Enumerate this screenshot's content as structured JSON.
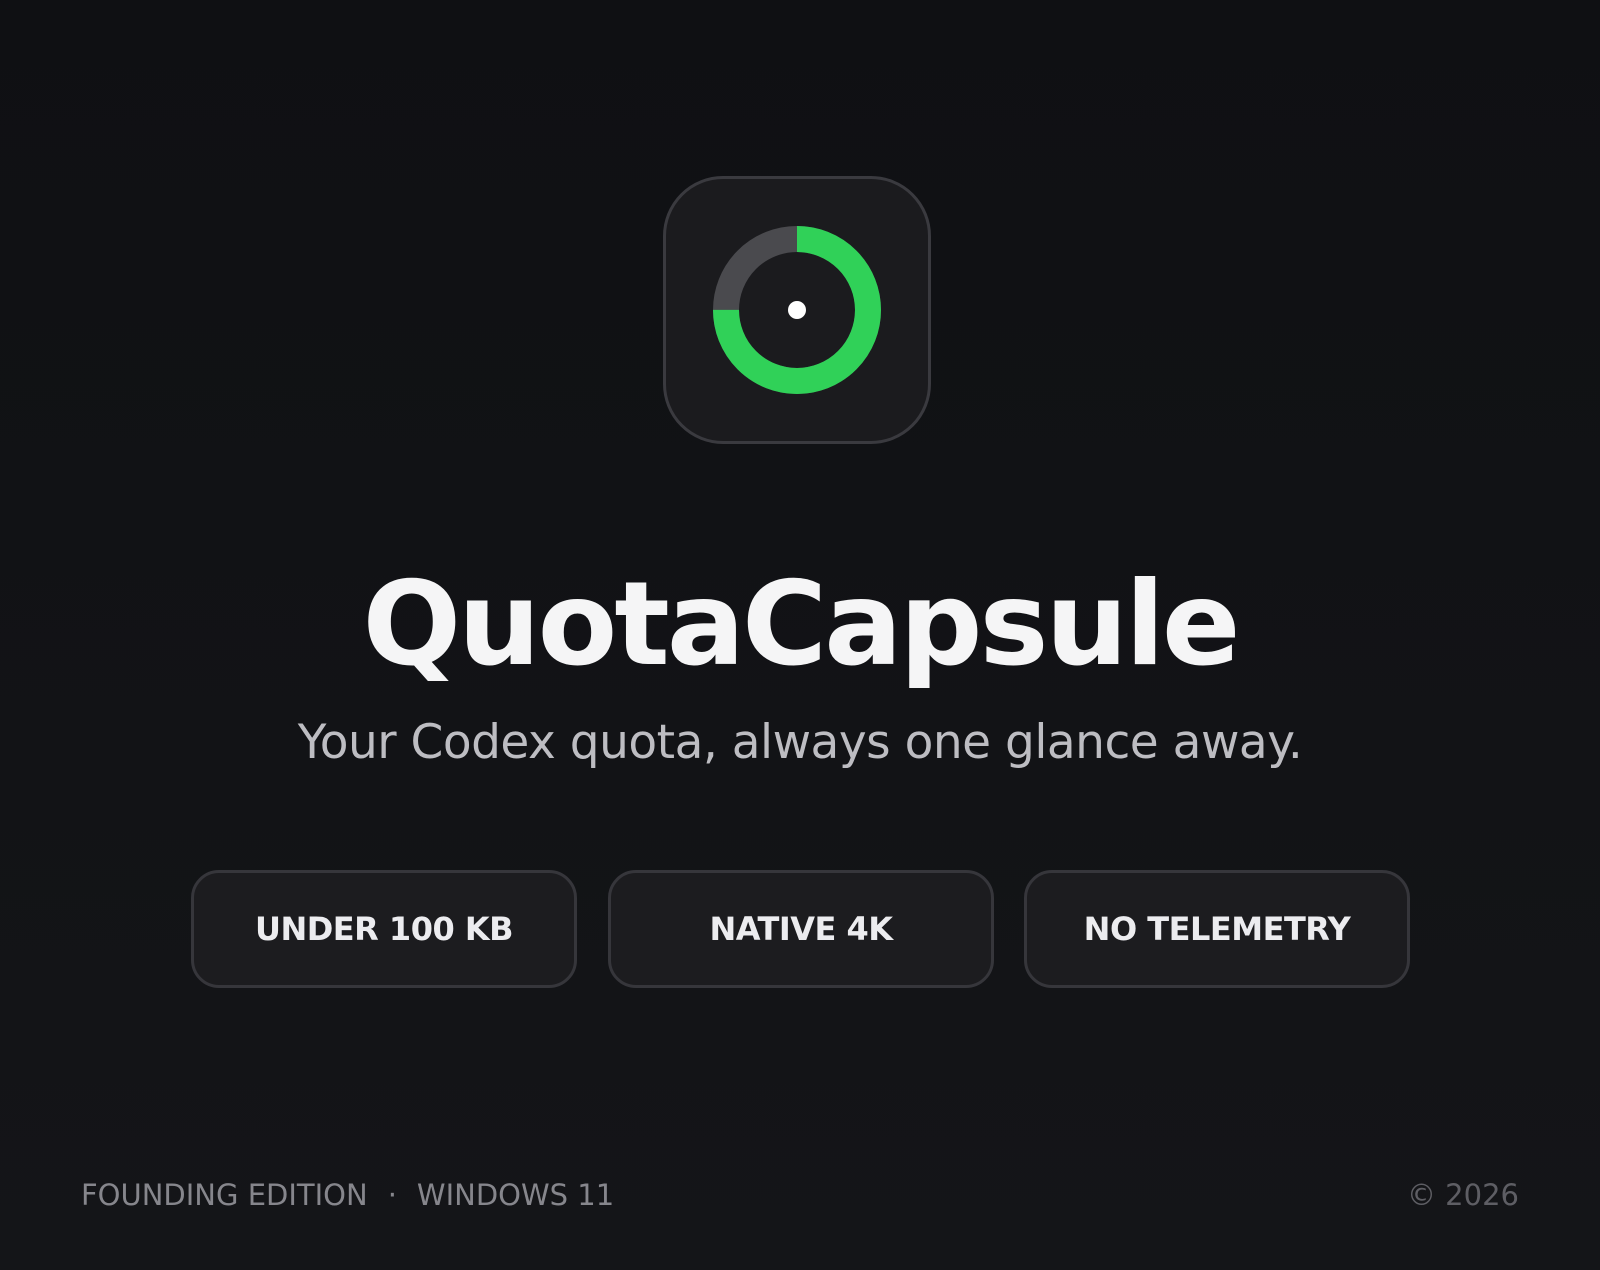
{
  "app": {
    "name": "QuotaCapsule",
    "tagline": "Your Codex quota, always one glance away.",
    "icon": "quota-ring-icon",
    "icon_ring_fill": 0.75,
    "accent_color": "#30d158",
    "ring_track_color": "#4a4a4e"
  },
  "badges": [
    {
      "label": "UNDER 100 KB"
    },
    {
      "label": "NATIVE 4K"
    },
    {
      "label": "NO TELEMETRY"
    }
  ],
  "footer": {
    "edition": "FOUNDING EDITION",
    "separator": "·",
    "platform": "WINDOWS 11",
    "copyright": "© 2026"
  }
}
